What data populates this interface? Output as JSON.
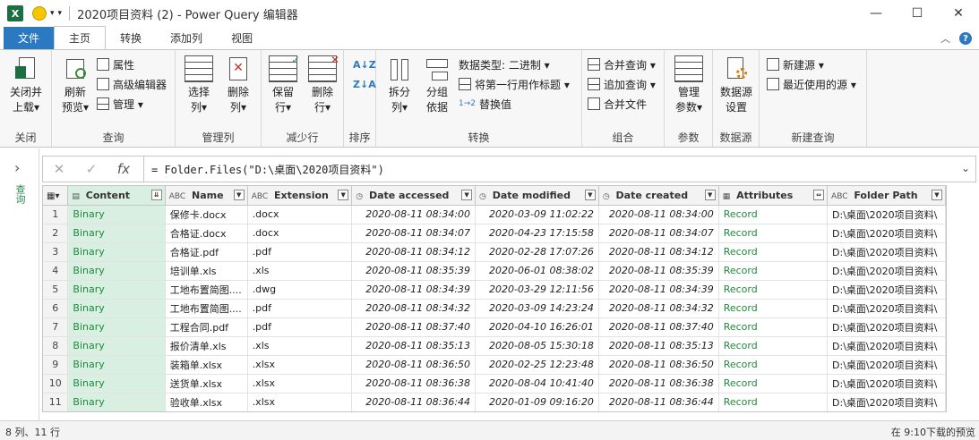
{
  "window": {
    "title": "2020项目资料 (2) - Power Query 编辑器",
    "app_icon": "X",
    "controls": {
      "minimize": "—",
      "maximize": "☐",
      "close": "✕"
    }
  },
  "tabs": [
    {
      "label": "文件"
    },
    {
      "label": "主页"
    },
    {
      "label": "转换"
    },
    {
      "label": "添加列"
    },
    {
      "label": "视图"
    }
  ],
  "ribbon": {
    "close": {
      "btn": "关闭并\n上载▾",
      "group": "关闭"
    },
    "query": {
      "refresh": "刷新\n预览▾",
      "properties": "属性",
      "advanced": "高级编辑器",
      "manage": "管理 ▾",
      "group": "查询"
    },
    "manage_cols": {
      "choose": "选择\n列▾",
      "remove": "删除\n列▾",
      "group": "管理列"
    },
    "reduce_rows": {
      "keep": "保留\n行▾",
      "remove": "删除\n行▾",
      "group": "减少行"
    },
    "sort": {
      "group": "排序"
    },
    "transform": {
      "split": "拆分\n列▾",
      "groupby": "分组\n依据",
      "datatype": "数据类型: 二进制 ▾",
      "firstrow": "将第一行用作标题 ▾",
      "replace": "替换值",
      "group": "转换"
    },
    "combine": {
      "merge": "合并查询 ▾",
      "append": "追加查询 ▾",
      "files": "合并文件",
      "group": "组合"
    },
    "params": {
      "manage": "管理\n参数▾",
      "group": "参数"
    },
    "datasource": {
      "settings": "数据源\n设置",
      "group": "数据源"
    },
    "newquery": {
      "new": "新建源 ▾",
      "recent": "最近使用的源 ▾",
      "group": "新建查询"
    }
  },
  "left_panel": {
    "label": "查询"
  },
  "formula_bar": {
    "cancel": "✕",
    "commit": "✓",
    "fx": "fx",
    "formula": "= Folder.Files(\"D:\\桌面\\2020项目资料\")"
  },
  "columns": [
    {
      "type": "",
      "name": "Content"
    },
    {
      "type": "ABC",
      "name": "Name"
    },
    {
      "type": "ABC",
      "name": "Extension"
    },
    {
      "type": "",
      "name": "Date accessed"
    },
    {
      "type": "",
      "name": "Date modified"
    },
    {
      "type": "",
      "name": "Date created"
    },
    {
      "type": "",
      "name": "Attributes"
    },
    {
      "type": "ABC",
      "name": "Folder Path"
    }
  ],
  "rows": [
    [
      "1",
      "Binary",
      "保修卡.docx",
      ".docx",
      "2020-08-11 08:34:00",
      "2020-03-09 11:02:22",
      "2020-08-11 08:34:00",
      "Record",
      "D:\\桌面\\2020项目资料\\"
    ],
    [
      "2",
      "Binary",
      "合格证.docx",
      ".docx",
      "2020-08-11 08:34:07",
      "2020-04-23 17:15:58",
      "2020-08-11 08:34:07",
      "Record",
      "D:\\桌面\\2020项目资料\\"
    ],
    [
      "3",
      "Binary",
      "合格证.pdf",
      ".pdf",
      "2020-08-11 08:34:12",
      "2020-02-28 17:07:26",
      "2020-08-11 08:34:12",
      "Record",
      "D:\\桌面\\2020项目资料\\"
    ],
    [
      "4",
      "Binary",
      "培训单.xls",
      ".xls",
      "2020-08-11 08:35:39",
      "2020-06-01 08:38:02",
      "2020-08-11 08:35:39",
      "Record",
      "D:\\桌面\\2020项目资料\\"
    ],
    [
      "5",
      "Binary",
      "工地布置简图....",
      ".dwg",
      "2020-08-11 08:34:39",
      "2020-03-29 12:11:56",
      "2020-08-11 08:34:39",
      "Record",
      "D:\\桌面\\2020项目资料\\"
    ],
    [
      "6",
      "Binary",
      "工地布置简图....",
      ".pdf",
      "2020-08-11 08:34:32",
      "2020-03-09 14:23:24",
      "2020-08-11 08:34:32",
      "Record",
      "D:\\桌面\\2020项目资料\\"
    ],
    [
      "7",
      "Binary",
      "工程合同.pdf",
      ".pdf",
      "2020-08-11 08:37:40",
      "2020-04-10 16:26:01",
      "2020-08-11 08:37:40",
      "Record",
      "D:\\桌面\\2020项目资料\\"
    ],
    [
      "8",
      "Binary",
      "报价清单.xls",
      ".xls",
      "2020-08-11 08:35:13",
      "2020-08-05 15:30:18",
      "2020-08-11 08:35:13",
      "Record",
      "D:\\桌面\\2020项目资料\\"
    ],
    [
      "9",
      "Binary",
      "装箱单.xlsx",
      ".xlsx",
      "2020-08-11 08:36:50",
      "2020-02-25 12:23:48",
      "2020-08-11 08:36:50",
      "Record",
      "D:\\桌面\\2020项目资料\\"
    ],
    [
      "10",
      "Binary",
      "送货单.xlsx",
      ".xlsx",
      "2020-08-11 08:36:38",
      "2020-08-04 10:41:40",
      "2020-08-11 08:36:38",
      "Record",
      "D:\\桌面\\2020项目资料\\"
    ],
    [
      "11",
      "Binary",
      "验收单.xlsx",
      ".xlsx",
      "2020-08-11 08:36:44",
      "2020-01-09 09:16:20",
      "2020-08-11 08:36:44",
      "Record",
      "D:\\桌面\\2020项目资料\\"
    ]
  ],
  "status": {
    "left": "8 列、11 行",
    "right": "在 9:10下载的预览"
  },
  "colors": {
    "accent": "#2b79c1",
    "excel_green": "#1d6f42",
    "binary_bg": "#d9efe2",
    "binary_text": "#1f8a3c"
  }
}
